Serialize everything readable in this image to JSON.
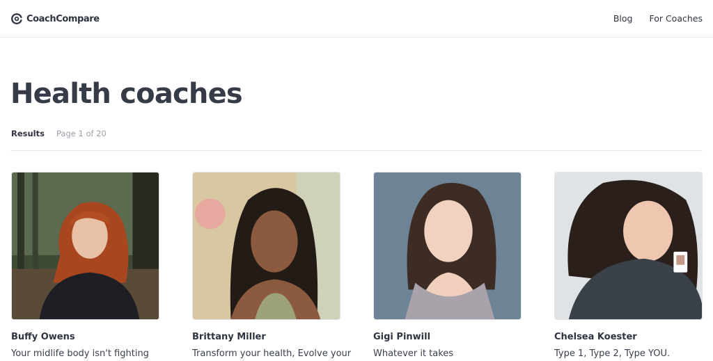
{
  "header": {
    "logo_text": "CoachCompare",
    "nav": [
      "Blog",
      "For Coaches"
    ]
  },
  "page": {
    "title": "Health coaches",
    "results_label": "Results",
    "page_info": "Page 1 of 20"
  },
  "coaches": [
    {
      "name": "Buffy Owens",
      "tagline": "Your midlife body isn't fighting"
    },
    {
      "name": "Brittany Miller",
      "tagline": "Transform your health, Evolve your"
    },
    {
      "name": "Gigi Pinwill",
      "tagline": "Whatever it takes"
    },
    {
      "name": "Chelsea Koester",
      "tagline": "Type 1, Type 2, Type YOU."
    }
  ]
}
